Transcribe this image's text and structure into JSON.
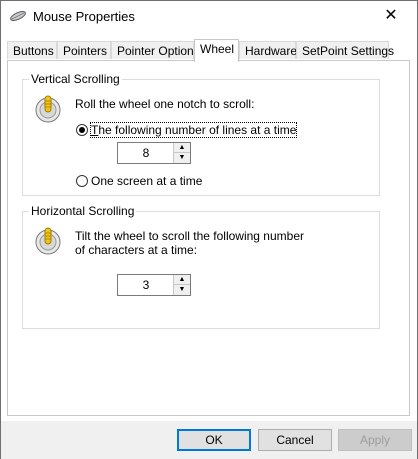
{
  "window": {
    "title": "Mouse Properties",
    "close_glyph": "✕"
  },
  "tabs": [
    {
      "label": "Buttons"
    },
    {
      "label": "Pointers"
    },
    {
      "label": "Pointer Options"
    },
    {
      "label": "Wheel",
      "active": true
    },
    {
      "label": "Hardware"
    },
    {
      "label": "SetPoint Settings"
    }
  ],
  "vertical": {
    "group_label": "Vertical Scrolling",
    "prompt": "Roll the wheel one notch to scroll:",
    "option_lines": "The following number of lines at a time",
    "lines_value": "8",
    "option_screen": "One screen at a time"
  },
  "horizontal": {
    "group_label": "Horizontal Scrolling",
    "prompt_line1": "Tilt the wheel to scroll the following number",
    "prompt_line2": "of characters at a time:",
    "chars_value": "3"
  },
  "buttons": {
    "ok": "OK",
    "cancel": "Cancel",
    "apply": "Apply"
  },
  "colors": {
    "accent": "#0078d7",
    "footer_bg": "#f0f0f0"
  },
  "icons": {
    "title": "mouse-icon",
    "wheel": "mouse-wheel-icon",
    "up": "chevron-up-icon",
    "down": "chevron-down-icon"
  }
}
